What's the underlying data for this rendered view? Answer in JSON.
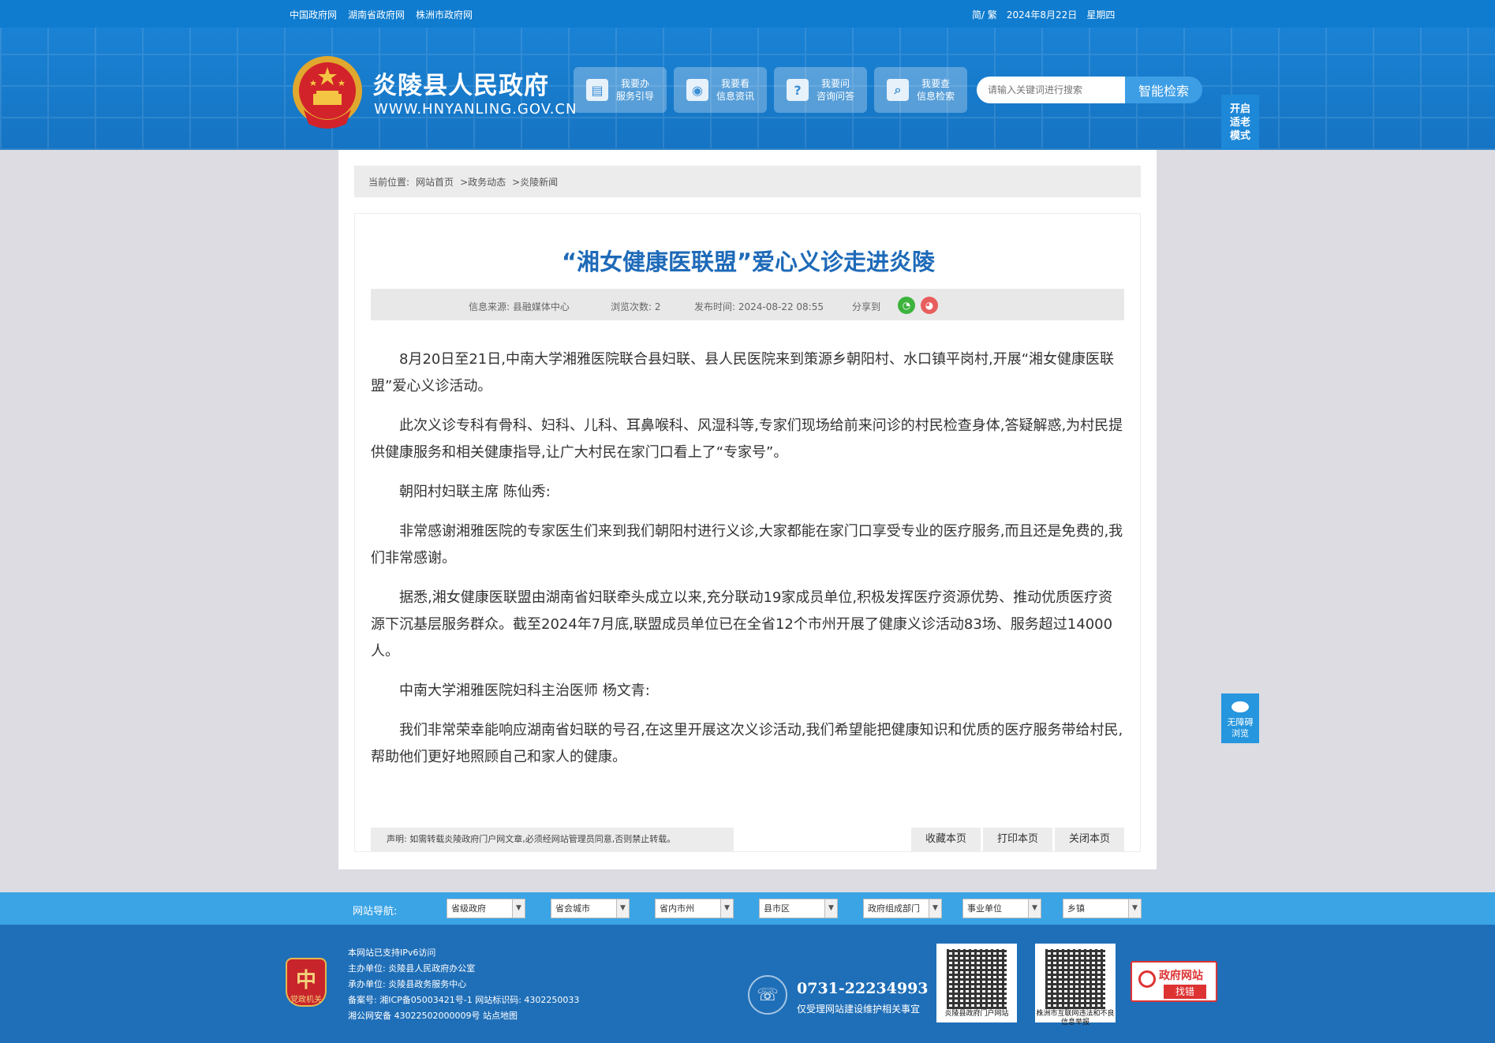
{
  "topbar": {
    "links": [
      "中国政府网",
      "湖南省政府网",
      "株洲市政府网"
    ],
    "lang": "简/ 繁",
    "date": "2024年8月22日",
    "weekday": "星期四"
  },
  "header": {
    "site_title": "炎陵县人民政府",
    "site_url": "WWW.HNYANLING.GOV.CN",
    "nav": [
      {
        "line1": "我要办",
        "line2": "服务引导"
      },
      {
        "line1": "我要看",
        "line2": "信息资讯"
      },
      {
        "line1": "我要问",
        "line2": "咨询问答"
      },
      {
        "line1": "我要查",
        "line2": "信息检索"
      }
    ],
    "search_placeholder": "请输入关键词进行搜索",
    "search_button": "智能检索",
    "elder_mode": [
      "开启",
      "适老",
      "模式"
    ]
  },
  "breadcrumb": {
    "label": "当前位置:",
    "items": [
      "网站首页",
      ">政务动态",
      ">炎陵新闻"
    ]
  },
  "article": {
    "title": "“湘女健康医联盟”爱心义诊走进炎陵",
    "source": "信息来源: 县融媒体中心",
    "views": "浏览次数: 2",
    "published": "发布时间: 2024-08-22 08:55",
    "share_label": "分享到",
    "paragraphs": [
      "8月20日至21日,中南大学湘雅医院联合县妇联、县人民医院来到策源乡朝阳村、水口镇平岗村,开展“湘女健康医联盟”爱心义诊活动。",
      "此次义诊专科有骨科、妇科、儿科、耳鼻喉科、风湿科等,专家们现场给前来问诊的村民检查身体,答疑解惑,为村民提供健康服务和相关健康指导,让广大村民在家门口看上了“专家号”。",
      "朝阳村妇联主席 陈仙秀:",
      "非常感谢湘雅医院的专家医生们来到我们朝阳村进行义诊,大家都能在家门口享受专业的医疗服务,而且还是免费的,我们非常感谢。",
      "据悉,湘女健康医联盟由湖南省妇联牵头成立以来,充分联动19家成员单位,积极发挥医疗资源优势、推动优质医疗资源下沉基层服务群众。截至2024年7月底,联盟成员单位已在全省12个市州开展了健康义诊活动83场、服务超过14000人。",
      "中南大学湘雅医院妇科主治医师 杨文青:",
      "我们非常荣幸能响应湖南省妇联的号召,在这里开展这次义诊活动,我们希望能把健康知识和优质的医疗服务带给村民,帮助他们更好地照顾自己和家人的健康。"
    ],
    "notice": "声明: 如需转载炎陵政府门户网文章,必须经网站管理员同意,否则禁止转载。",
    "buttons": [
      "收藏本页",
      "打印本页",
      "关闭本页"
    ]
  },
  "sitenav": {
    "label": "网站导航:",
    "selects": [
      "省级政府",
      "省会城市",
      "省内市州",
      "县市区",
      "政府组成部门",
      "事业单位",
      "乡镇"
    ]
  },
  "footer": {
    "lines": [
      "本网站已支持IPv6访问",
      "主办单位: 炎陵县人民政府办公室",
      "承办单位: 炎陵县政务服务中心",
      "备案号: 湘ICP备05003421号-1 网站标识码: 4302250033",
      "湘公网安备 43022502000009号 站点地图"
    ],
    "party_badge": "党政机关",
    "phone": "0731-22234993",
    "phone_note": "仅受理网站建设维护相关事宜",
    "qr1_caption": "炎陵县政府门户网站",
    "qr2_caption": "株洲市互联网违法和不良信息举报",
    "err_title": "政府网站",
    "err_sub": "找错"
  },
  "accessibility": [
    "无障碍",
    "浏览"
  ]
}
